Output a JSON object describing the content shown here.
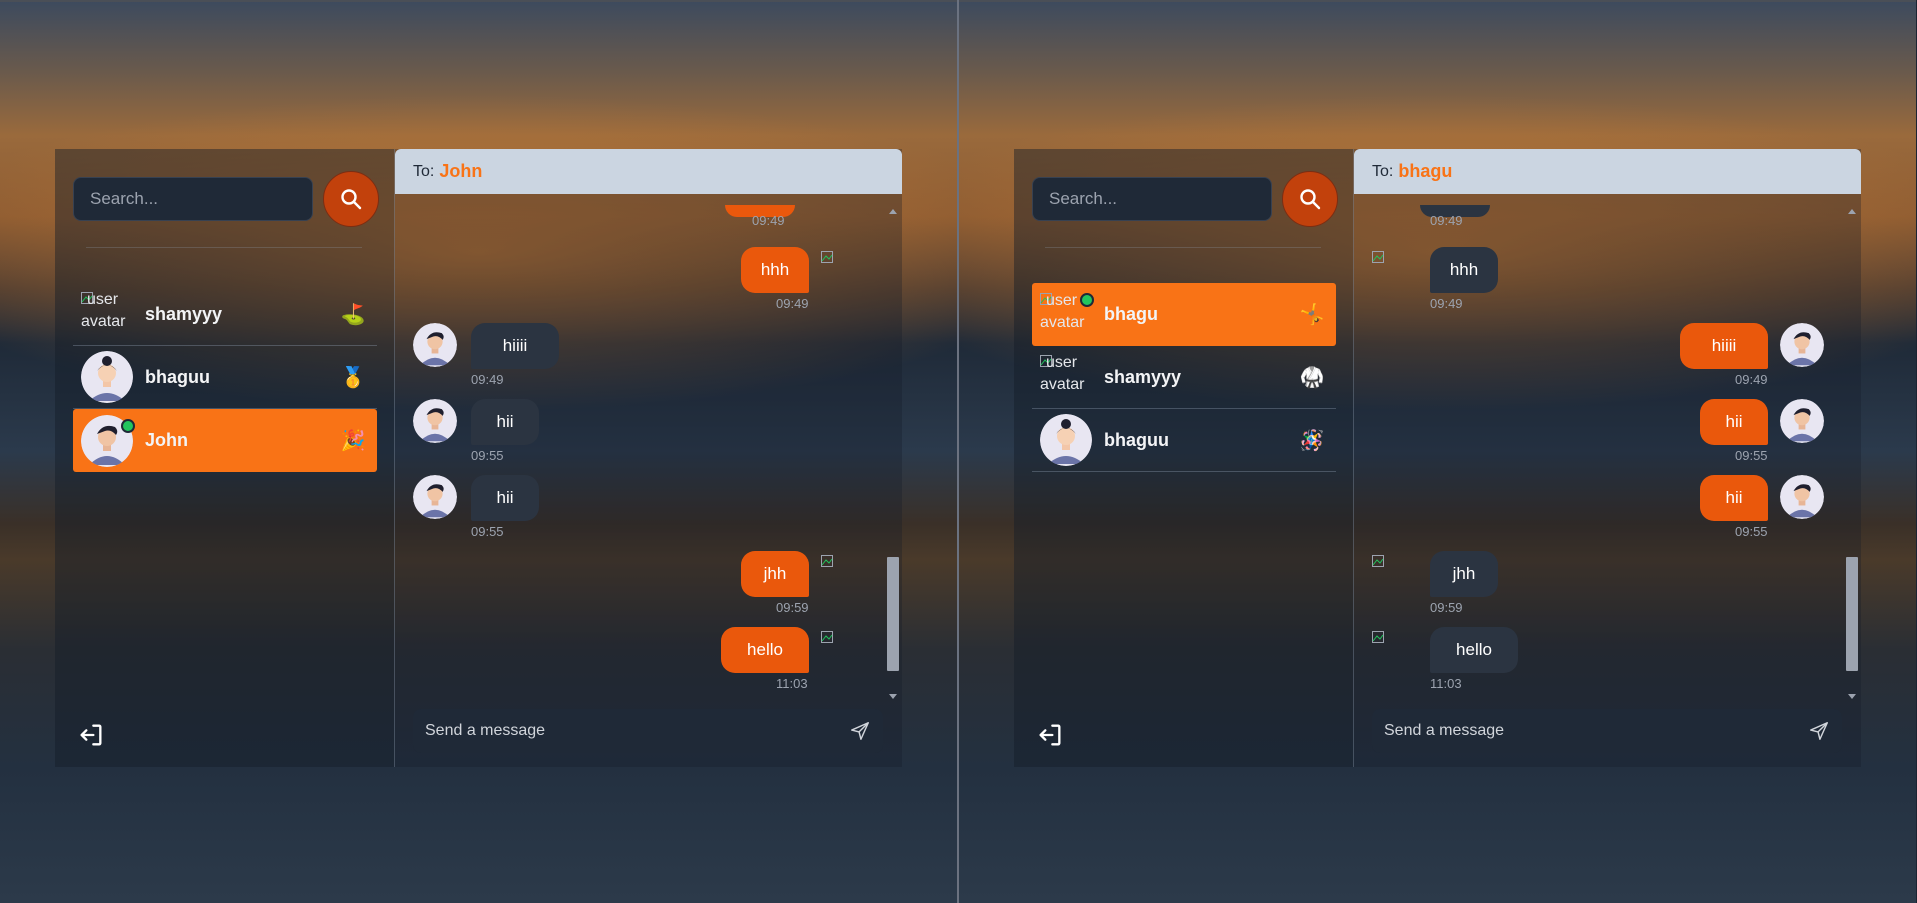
{
  "left": {
    "search_placeholder": "Search...",
    "conversations": [
      {
        "name": "shamyyy",
        "emoji": "⛳",
        "avatar": "broken",
        "broken_alt_line1": "user",
        "broken_alt_line2": "avatar"
      },
      {
        "name": "bhaguu",
        "emoji": "🥇",
        "avatar": "female"
      },
      {
        "name": "John",
        "emoji": "🎉",
        "avatar": "male",
        "online": true,
        "selected": true
      }
    ],
    "header": {
      "prefix": "To:",
      "recipient": "John"
    },
    "messages": [
      {
        "text": "hhh",
        "time": "09:49",
        "dir": "out"
      },
      {
        "text": "hiiii",
        "time": "09:49",
        "dir": "in"
      },
      {
        "text": "hii",
        "time": "09:55",
        "dir": "in"
      },
      {
        "text": "hii",
        "time": "09:55",
        "dir": "in"
      },
      {
        "text": "jhh",
        "time": "09:59",
        "dir": "out"
      },
      {
        "text": "hello",
        "time": "11:03",
        "dir": "out"
      }
    ],
    "partial_time": "09:49",
    "composer_placeholder": "Send a message"
  },
  "right": {
    "search_placeholder": "Search...",
    "conversations": [
      {
        "name": "bhagu",
        "emoji": "🤸",
        "avatar": "broken",
        "online": true,
        "selected": true,
        "broken_alt_line1": "user",
        "broken_alt_line2": "avatar"
      },
      {
        "name": "shamyyy",
        "emoji": "🥋",
        "avatar": "broken",
        "broken_alt_line1": "user",
        "broken_alt_line2": "avatar"
      },
      {
        "name": "bhaguu",
        "emoji": "🪅",
        "avatar": "female"
      }
    ],
    "header": {
      "prefix": "To:",
      "recipient": "bhagu"
    },
    "messages": [
      {
        "text": "hhh",
        "time": "09:49",
        "dir": "in"
      },
      {
        "text": "hiiii",
        "time": "09:49",
        "dir": "out"
      },
      {
        "text": "hii",
        "time": "09:55",
        "dir": "out"
      },
      {
        "text": "hii",
        "time": "09:55",
        "dir": "out"
      },
      {
        "text": "jhh",
        "time": "09:59",
        "dir": "in"
      },
      {
        "text": "hello",
        "time": "11:03",
        "dir": "in"
      }
    ],
    "partial_time": "09:49",
    "composer_placeholder": "Send a message"
  },
  "colors": {
    "accent": "#f97316",
    "outgoing_bubble": "#ea580c",
    "incoming_bubble": "#2b3441",
    "header_bg": "#cbd5e1",
    "online": "#22c55e"
  }
}
